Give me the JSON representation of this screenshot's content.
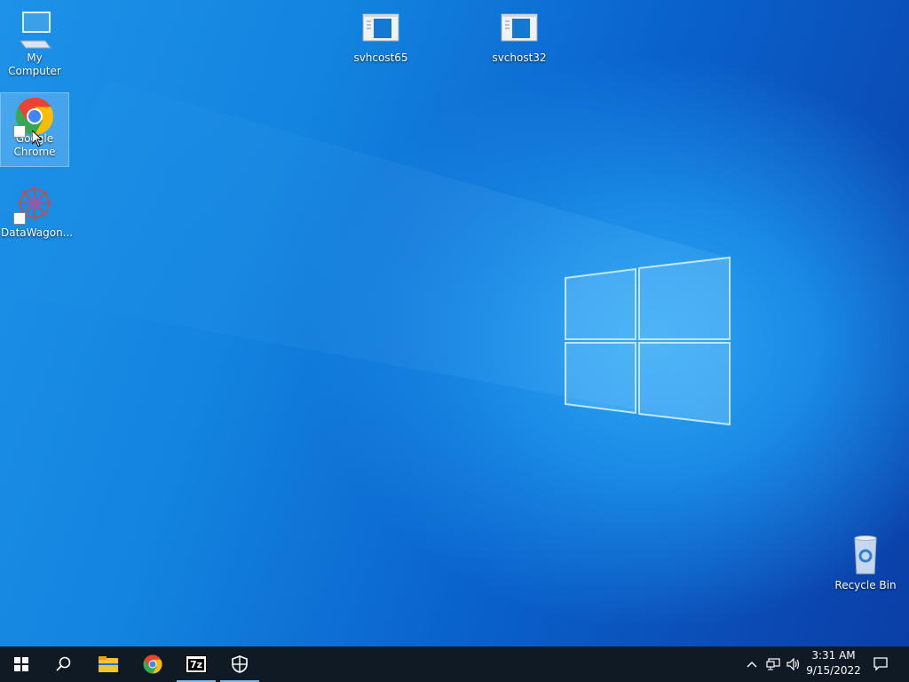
{
  "desktop": {
    "icons": [
      {
        "label": "My Computer"
      },
      {
        "label": "svhcost65"
      },
      {
        "label": "svchost32"
      },
      {
        "label_line1": "Google",
        "label_line2": "Chrome"
      },
      {
        "label": "DataWagon..."
      },
      {
        "label": "Recycle Bin"
      }
    ]
  },
  "taskbar": {
    "clock": {
      "time": "3:31 AM",
      "date": "9/15/2022"
    },
    "pinned": [
      "start-icon",
      "search-icon",
      "file-explorer-icon",
      "chrome-icon",
      "7zip-icon",
      "security-icon"
    ],
    "sevenzip_text": "7z"
  },
  "colors": {
    "taskbar": "#101a24",
    "accent": "#76b9ed"
  }
}
